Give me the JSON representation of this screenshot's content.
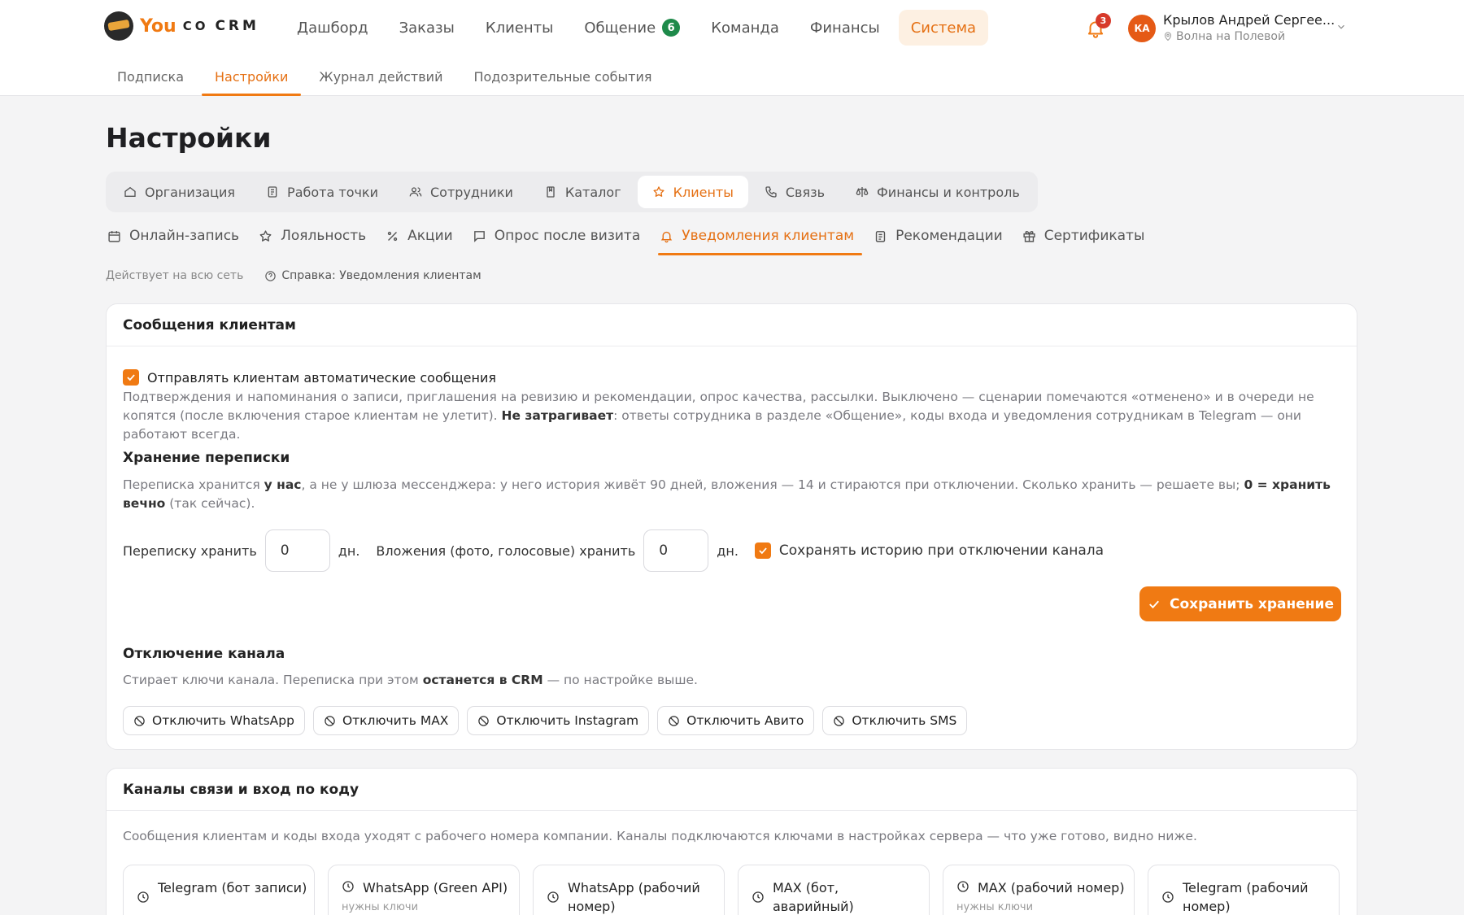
{
  "brand": {
    "you": "You",
    "co": "CO",
    "crm": "CRM"
  },
  "mainnav": [
    {
      "label": "Дашборд"
    },
    {
      "label": "Заказы"
    },
    {
      "label": "Клиенты"
    },
    {
      "label": "Общение",
      "badge": "6"
    },
    {
      "label": "Команда"
    },
    {
      "label": "Финансы"
    },
    {
      "label": "Система",
      "active": true
    }
  ],
  "notifications": {
    "count": "3"
  },
  "user": {
    "initials": "КА",
    "name": "Крылов Андрей Сергее...",
    "location": "Волна на Полевой"
  },
  "subnav": [
    "Подписка",
    "Настройки",
    "Журнал действий",
    "Подозрительные события"
  ],
  "page": {
    "title": "Настройки"
  },
  "tabs1": [
    {
      "label": "Организация",
      "icon": "home-icon"
    },
    {
      "label": "Работа точки",
      "icon": "document-icon"
    },
    {
      "label": "Сотрудники",
      "icon": "users-icon"
    },
    {
      "label": "Каталог",
      "icon": "book-icon"
    },
    {
      "label": "Клиенты",
      "icon": "star-icon",
      "active": true
    },
    {
      "label": "Связь",
      "icon": "phone-icon"
    },
    {
      "label": "Финансы и контроль",
      "icon": "scales-icon"
    }
  ],
  "tabs2": [
    {
      "label": "Онлайн-запись",
      "icon": "calendar-icon"
    },
    {
      "label": "Лояльность",
      "icon": "star-icon"
    },
    {
      "label": "Акции",
      "icon": "percent-icon"
    },
    {
      "label": "Опрос после визита",
      "icon": "chat-icon"
    },
    {
      "label": "Уведомления клиентам",
      "icon": "bell-icon",
      "active": true
    },
    {
      "label": "Рекомендации",
      "icon": "clipboard-icon"
    },
    {
      "label": "Сертификаты",
      "icon": "gift-icon"
    }
  ],
  "scope": {
    "text": "Действует на всю сеть",
    "help": "Справка: Уведомления клиентам"
  },
  "messages_card": {
    "title": "Сообщения клиентам",
    "auto_label": "Отправлять клиентам автоматические сообщения",
    "auto_checked": true,
    "auto_desc_1": "Подтверждения и напоминания о записи, приглашения на ревизию и рекомендации, опрос качества, рассылки. Выключено — сценарии помечаются «отменено» и в очереди не копятся (после включения старое клиентам не улетит). ",
    "auto_desc_bold": "Не затрагивает",
    "auto_desc_2": ": ответы сотрудника в разделе «Общение», коды входа и уведомления сотрудникам в Telegram — они работают всегда.",
    "storage_title": "Хранение переписки",
    "storage_desc_1": "Переписка хранится ",
    "storage_desc_b1": "у нас",
    "storage_desc_2": ", а не у шлюза мессенджера: у него история живёт 90 дней, вложения — 14 и стираются при отключении. Сколько хранить — решаете вы; ",
    "storage_desc_b2": "0 = хранить вечно",
    "storage_desc_3": " (так сейчас).",
    "keep_label": "Переписку хранить",
    "keep_value": "0",
    "days": "дн.",
    "attach_label": "Вложения (фото, голосовые) хранить",
    "attach_value": "0",
    "days2": "дн.",
    "history_label": "Сохранять историю при отключении канала",
    "history_checked": true,
    "save_label": "Сохранить хранение",
    "disconnect_title": "Отключение канала",
    "disconnect_desc_1": "Стирает ключи канала. Переписка при этом ",
    "disconnect_desc_b": "останется в CRM",
    "disconnect_desc_2": " — по настройке выше.",
    "disconnect_buttons": [
      "Отключить WhatsApp",
      "Отключить MAX",
      "Отключить Instagram",
      "Отключить Авито",
      "Отключить SMS"
    ]
  },
  "channels_card": {
    "title": "Каналы связи и вход по коду",
    "desc": "Сообщения клиентам и коды входа уходят с рабочего номера компании. Каналы подключаются ключами в настройках сервера — что уже готово, видно ниже.",
    "channels": [
      {
        "title": "Telegram (бот записи)",
        "sub": ""
      },
      {
        "title": "WhatsApp (Green API)",
        "sub": "нужны ключи"
      },
      {
        "title": "WhatsApp (рабочий номер)",
        "sub": ""
      },
      {
        "title": "MAX (бот, аварийный)",
        "sub": ""
      },
      {
        "title": "MAX (рабочий номер)",
        "sub": "нужны ключи"
      },
      {
        "title": "Telegram (рабочий номер)",
        "sub": ""
      }
    ]
  },
  "colors": {
    "accent": "#f07a13",
    "accent_bg": "#fdf0e2",
    "badge_green": "#1e8a4a",
    "danger": "#d73a2a"
  }
}
